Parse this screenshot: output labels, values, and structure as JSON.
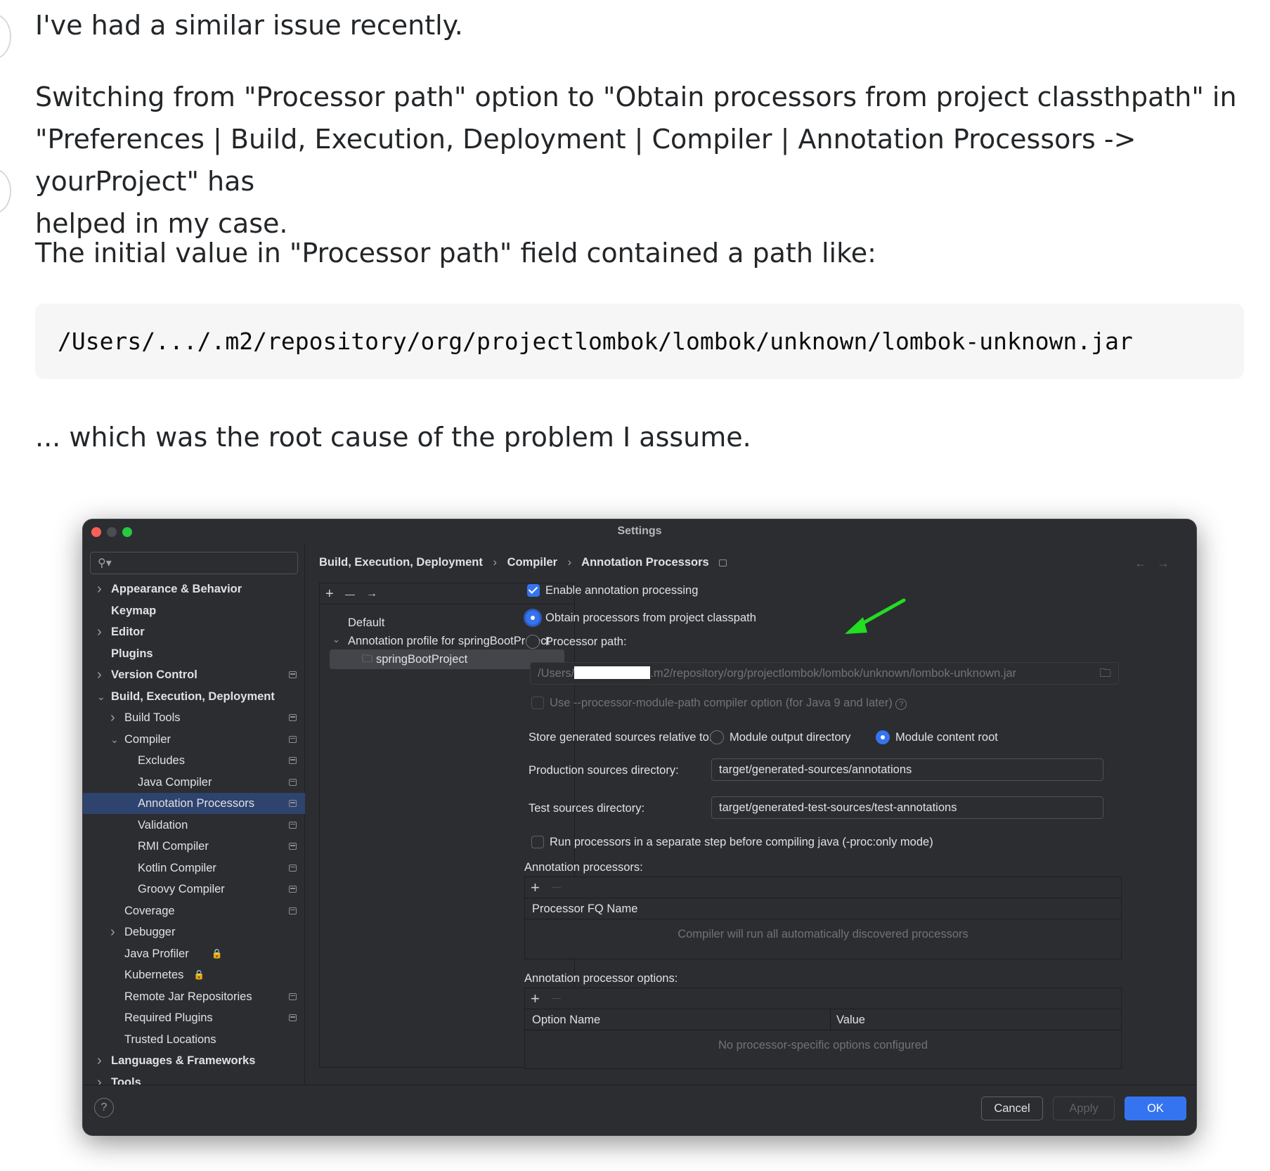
{
  "post": {
    "p1": "I've had a similar issue recently.",
    "p2a": "Switching from \"Processor path\" option to \"Obtain processors from project classthpath\" in",
    "p2b": "\"Preferences | Build, Execution, Deployment | Compiler | Annotation Processors -> yourProject\" has",
    "p2c": "helped in my case.",
    "p3": "The initial value in \"Processor path\" field contained a path like:",
    "code": "/Users/.../.m2/repository/org/projectlombok/lombok/unknown/lombok-unknown.jar",
    "p4": "... which was the root cause of the problem I assume."
  },
  "window": {
    "title": "Settings",
    "traffic_colors": [
      "#ff5f57",
      "#4a4d52",
      "#28c840"
    ],
    "accent": "#3574f0",
    "selection": "#2e436e",
    "annotation_arrow_color": "#22dd22"
  },
  "sidebar": {
    "search_icon": "search-icon",
    "items": [
      {
        "label": "Appearance & Behavior",
        "bold": true,
        "chevron": "right",
        "level": 0
      },
      {
        "label": "Keymap",
        "bold": true,
        "level": 0
      },
      {
        "label": "Editor",
        "bold": true,
        "chevron": "right",
        "level": 0
      },
      {
        "label": "Plugins",
        "bold": true,
        "level": 0
      },
      {
        "label": "Version Control",
        "bold": true,
        "chevron": "right",
        "level": 0,
        "module_icon": true
      },
      {
        "label": "Build, Execution, Deployment",
        "bold": true,
        "chevron": "down",
        "level": 0
      },
      {
        "label": "Build Tools",
        "chevron": "right",
        "level": 1,
        "module_icon": true
      },
      {
        "label": "Compiler",
        "chevron": "down",
        "level": 1,
        "module_icon": true
      },
      {
        "label": "Excludes",
        "level": 2,
        "module_icon": true
      },
      {
        "label": "Java Compiler",
        "level": 2,
        "module_icon": true
      },
      {
        "label": "Annotation Processors",
        "level": 2,
        "module_icon": true,
        "selected": true
      },
      {
        "label": "Validation",
        "level": 2,
        "module_icon": true
      },
      {
        "label": "RMI Compiler",
        "level": 2,
        "module_icon": true
      },
      {
        "label": "Kotlin Compiler",
        "level": 2,
        "module_icon": true
      },
      {
        "label": "Groovy Compiler",
        "level": 2,
        "module_icon": true
      },
      {
        "label": "Coverage",
        "level": 1,
        "module_icon": true
      },
      {
        "label": "Debugger",
        "chevron": "right",
        "level": 1
      },
      {
        "label": "Java Profiler",
        "level": 1,
        "lock": true
      },
      {
        "label": "Kubernetes",
        "level": 1,
        "lock": true
      },
      {
        "label": "Remote Jar Repositories",
        "level": 1,
        "module_icon": true
      },
      {
        "label": "Required Plugins",
        "level": 1,
        "module_icon": true
      },
      {
        "label": "Trusted Locations",
        "level": 1
      },
      {
        "label": "Languages & Frameworks",
        "bold": true,
        "chevron": "right",
        "level": 0
      },
      {
        "label": "Tools",
        "bold": true,
        "chevron": "right",
        "level": 0
      }
    ]
  },
  "breadcrumb": {
    "b1": "Build, Execution, Deployment",
    "b2": "Compiler",
    "b3": "Annotation Processors",
    "sep": "›"
  },
  "profiles": {
    "toolbar": {
      "add": "+",
      "remove": "—",
      "move": "→"
    },
    "default": "Default",
    "profile": "Annotation profile for springBootProject",
    "module": "springBootProject"
  },
  "settings": {
    "enable_label": "Enable annotation processing",
    "enable_checked": true,
    "obtain_label": "Obtain processors from project classpath",
    "path_label": "Processor path:",
    "path_prefix": "/Users/",
    "path_suffix": ".m2/repository/org/projectlombok/lombok/unknown/lombok-unknown.jar",
    "module_path_label": "Use --processor-module-path compiler option (for Java 9 and later)",
    "store_label": "Store generated sources relative to:",
    "store_opt1": "Module output directory",
    "store_opt2": "Module content root",
    "prod_label": "Production sources directory:",
    "prod_value": "target/generated-sources/annotations",
    "test_label": "Test sources directory:",
    "test_value": "target/generated-test-sources/test-annotations",
    "separate_label": "Run processors in a separate step before compiling java (-proc:only mode)"
  },
  "processors_table": {
    "title": "Annotation processors:",
    "add": "+",
    "remove": "—",
    "column": "Processor FQ Name",
    "empty": "Compiler will run all automatically discovered processors"
  },
  "options_table": {
    "title": "Annotation processor options:",
    "add": "+",
    "remove": "—",
    "col1": "Option Name",
    "col2": "Value",
    "empty": "No processor-specific options configured"
  },
  "footer": {
    "help": "?",
    "cancel": "Cancel",
    "apply": "Apply",
    "ok": "OK"
  }
}
